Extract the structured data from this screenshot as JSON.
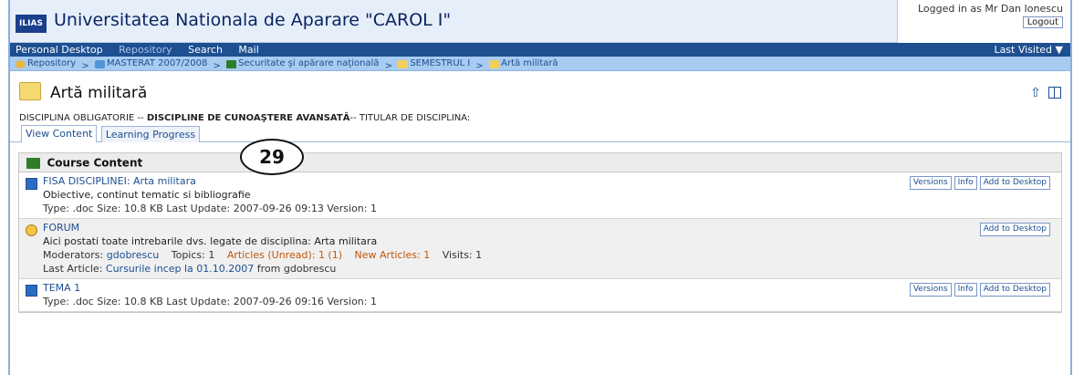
{
  "header": {
    "logo_text": "ILIAS",
    "site_title": "Universitatea Nationala de Aparare \"CAROL I\"",
    "logged_in": "Logged in as Mr Dan Ionescu",
    "logout_label": "Logout"
  },
  "nav": {
    "items": [
      {
        "label": "Personal Desktop"
      },
      {
        "label": "Repository"
      },
      {
        "label": "Search"
      },
      {
        "label": "Mail"
      }
    ],
    "last_visited": "Last Visited ▼"
  },
  "breadcrumb": {
    "items": [
      {
        "label": "Repository",
        "icon": "repository-icon"
      },
      {
        "label": "MASTERAT 2007/2008",
        "icon": "category-icon"
      },
      {
        "label": "Securitate şi apărare naţională",
        "icon": "course-icon"
      },
      {
        "label": "SEMESTRUL I",
        "icon": "folder-icon"
      },
      {
        "label": "Artă militară",
        "icon": "folder-icon"
      }
    ],
    "separator": ">"
  },
  "page": {
    "title": "Artă militară",
    "description_prefix": "DISCIPLINA OBLIGATORIE --",
    "description_bold": "DISCIPLINE DE CUNOAŞTERE AVANSATĂ",
    "description_suffix": "-- TITULAR DE DISCIPLINA:"
  },
  "tabs": [
    {
      "label": "View Content",
      "active": true
    },
    {
      "label": "Learning Progress",
      "active": false
    }
  ],
  "content": {
    "block_title": "Course Content",
    "callout_number": "29",
    "items": [
      {
        "title": "FISA DISCIPLINEI: Arta militara",
        "description": "Obiective, continut tematic si bibliografie",
        "meta": "Type: .doc   Size: 10.8 KB   Last Update: 2007-09-26 09:13   Version: 1",
        "actions": [
          "Versions",
          "Info",
          "Add to Desktop"
        ]
      },
      {
        "title": "FORUM",
        "description": "Aici postati toate intrebarile dvs. legate de disciplina: Arta militara",
        "moderators_label": "Moderators:",
        "moderator": "gdobrescu",
        "topics": "Topics: 1",
        "articles_unread": "Articles (Unread): 1 (1)",
        "new_articles": "New Articles: 1",
        "visits": "Visits: 1",
        "last_article_label": "Last Article:",
        "last_article_link": "Cursurile incep la 01.10.2007",
        "last_article_from": "from gdobrescu",
        "actions": [
          "Add to Desktop"
        ]
      },
      {
        "title": "TEMA 1",
        "meta": "Type: .doc   Size: 10.8 KB   Last Update: 2007-09-26 09:16   Version: 1",
        "actions": [
          "Versions",
          "Info",
          "Add to Desktop"
        ]
      }
    ]
  }
}
